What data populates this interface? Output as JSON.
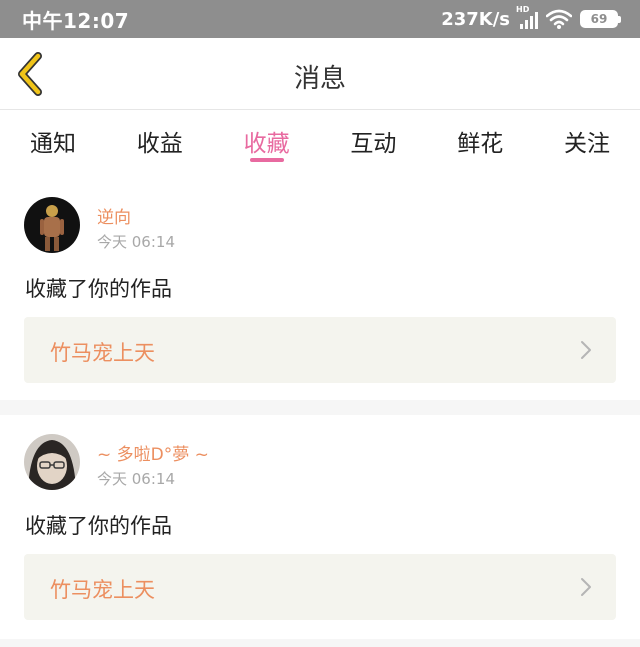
{
  "status_bar": {
    "time": "中午12:07",
    "net_speed": "237K/s",
    "hd_label": "HD",
    "battery": "69"
  },
  "header": {
    "title": "消息"
  },
  "tabs": [
    {
      "label": "通知"
    },
    {
      "label": "收益"
    },
    {
      "label": "收藏",
      "active": true
    },
    {
      "label": "互动"
    },
    {
      "label": "鲜花"
    },
    {
      "label": "关注"
    }
  ],
  "messages": [
    {
      "username": "逆向",
      "time": "今天 06:14",
      "action": "收藏了你的作品",
      "work_title": "竹马宠上天"
    },
    {
      "username": "~ 多啦D°夢 ~",
      "time": "今天 06:14",
      "action": "收藏了你的作品",
      "work_title": "竹马宠上天"
    }
  ],
  "colors": {
    "accent_pink": "#e86aa0",
    "accent_orange": "#ec8f60",
    "back_arrow": "#f0c419",
    "status_bar_bg": "#8e8e8e",
    "card_bg": "#f4f4ee"
  },
  "icons": [
    "back-arrow-icon",
    "chevron-right-icon",
    "signal-icon",
    "wifi-icon",
    "battery-icon"
  ]
}
